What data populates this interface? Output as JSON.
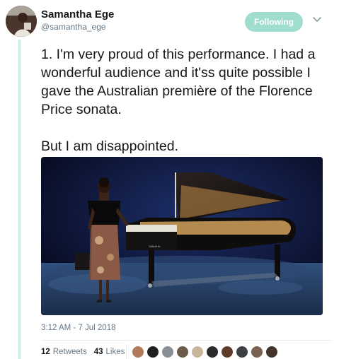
{
  "author": {
    "name": "Samantha Ege",
    "handle": "@samantha_ege",
    "follow_label": "Following"
  },
  "tweet": {
    "text": "1. I'm very proud of this performance. I had a wonderful audience and it'ss quite possible I gave the Australian première of the Florence Price sonata.\n\nBut I am disappointed.",
    "timestamp": "3:12 AM - 7 Jul 2018",
    "piano_brand": "YAMAHA"
  },
  "stats": {
    "retweets_count": "12",
    "retweets_label": "Retweets",
    "likes_count": "43",
    "likes_label": "Likes"
  },
  "likers": [
    {
      "color": "#b07a5a"
    },
    {
      "color": "#1f1f1f"
    },
    {
      "color": "#8a8f96"
    },
    {
      "color": "#6d5b4a"
    },
    {
      "color": "#c9b59a"
    },
    {
      "color": "#2b2b2b"
    },
    {
      "color": "#5d3c2a"
    },
    {
      "color": "#3c3f44"
    },
    {
      "color": "#7a6252"
    },
    {
      "color": "#44352c"
    }
  ],
  "colors": {
    "follow_button": "#9fdecf",
    "thread_line": "#c7ece4",
    "muted_text": "#657786"
  }
}
